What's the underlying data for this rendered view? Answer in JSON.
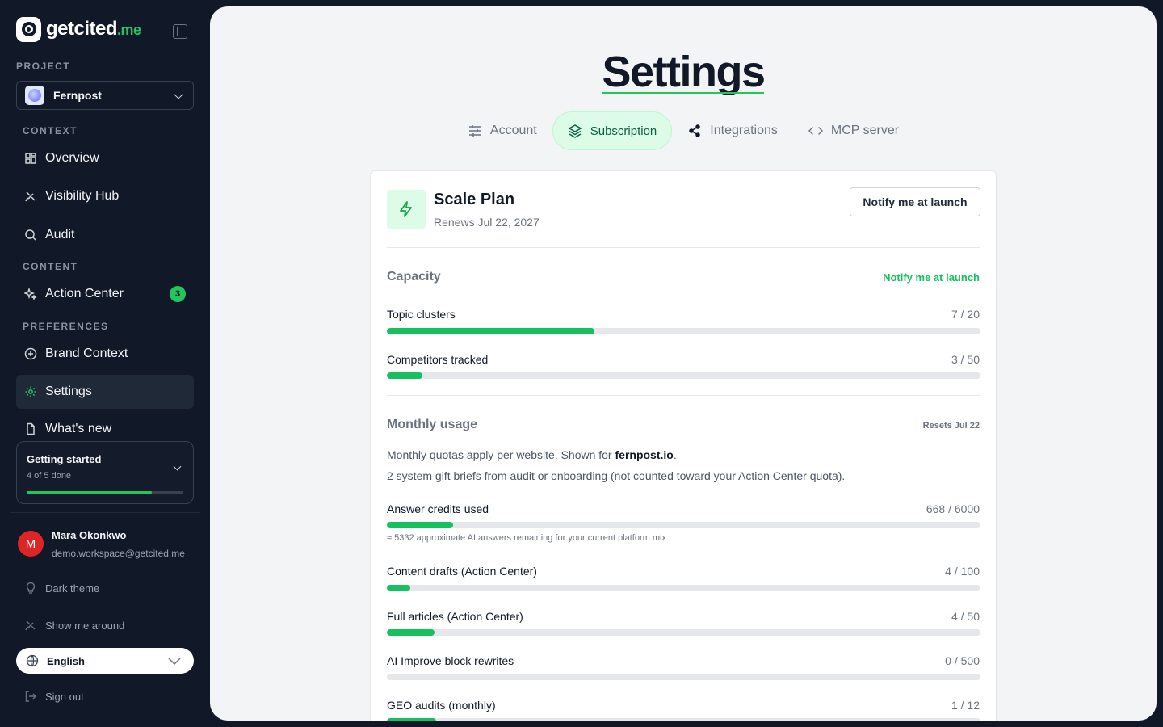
{
  "brand": {
    "name": "getcited",
    "tld": ".me"
  },
  "sidebar": {
    "project_label": "PROJECT",
    "project_name": "Fernpost",
    "context_label": "CONTEXT",
    "content_label": "CONTENT",
    "preferences_label": "PREFERENCES",
    "items": [
      {
        "label": "Overview",
        "icon": "grid-icon"
      },
      {
        "label": "Visibility Hub",
        "icon": "satellite-icon"
      },
      {
        "label": "Audit",
        "icon": "search-icon"
      },
      {
        "label": "Action Center",
        "icon": "sparkles-icon",
        "badge": "3"
      },
      {
        "label": "Brand Context",
        "icon": "plus-circle-icon"
      },
      {
        "label": "Settings",
        "icon": "gear-icon",
        "active": true
      },
      {
        "label": "What's new",
        "icon": "document-icon"
      }
    ],
    "getting_started": {
      "title": "Getting started",
      "progress_text": "4 of 5 done",
      "progress": 0.8
    },
    "user": {
      "initial": "M",
      "name": "Mara Okonkwo",
      "email": "demo.workspace@getcited.me"
    },
    "dark_theme_label": "Dark theme",
    "tour_label": "Show me around",
    "language": "English",
    "sign_out_label": "Sign out"
  },
  "main": {
    "title": "Settings",
    "tabs": [
      {
        "label": "Account",
        "icon": "sliders-icon"
      },
      {
        "label": "Subscription",
        "icon": "layers-icon",
        "active": true
      },
      {
        "label": "Integrations",
        "icon": "share-icon"
      },
      {
        "label": "MCP server",
        "icon": "code-icon"
      }
    ],
    "plan": {
      "name": "Scale Plan",
      "renews": "Renews Jul 22, 2027",
      "notify_button": "Notify me at launch"
    },
    "capacity": {
      "title": "Capacity",
      "link": "Notify me at launch",
      "meters": [
        {
          "label": "Topic clusters",
          "value": "7 / 20",
          "used": 7,
          "limit": 20
        },
        {
          "label": "Competitors tracked",
          "value": "3 / 50",
          "used": 3,
          "limit": 50
        }
      ]
    },
    "usage": {
      "title": "Monthly usage",
      "resets": "Resets Jul 22",
      "desc_prefix": "Monthly quotas apply per website. Shown for ",
      "desc_site": "fernpost.io",
      "desc_suffix": ".",
      "gift_note": "2 system gift briefs from audit or onboarding (not counted toward your Action Center quota).",
      "meters": [
        {
          "label": "Answer credits used",
          "value": "668 / 6000",
          "used": 668,
          "limit": 6000,
          "note": "≈ 5332 approximate AI answers remaining for your current platform mix"
        },
        {
          "label": "Content drafts (Action Center)",
          "value": "4 / 100",
          "used": 4,
          "limit": 100
        },
        {
          "label": "Full articles (Action Center)",
          "value": "4 / 50",
          "used": 4,
          "limit": 50
        },
        {
          "label": "AI Improve block rewrites",
          "value": "0 / 500",
          "used": 0,
          "limit": 500
        },
        {
          "label": "GEO audits (monthly)",
          "value": "1 / 12",
          "used": 1,
          "limit": 12
        }
      ]
    }
  }
}
